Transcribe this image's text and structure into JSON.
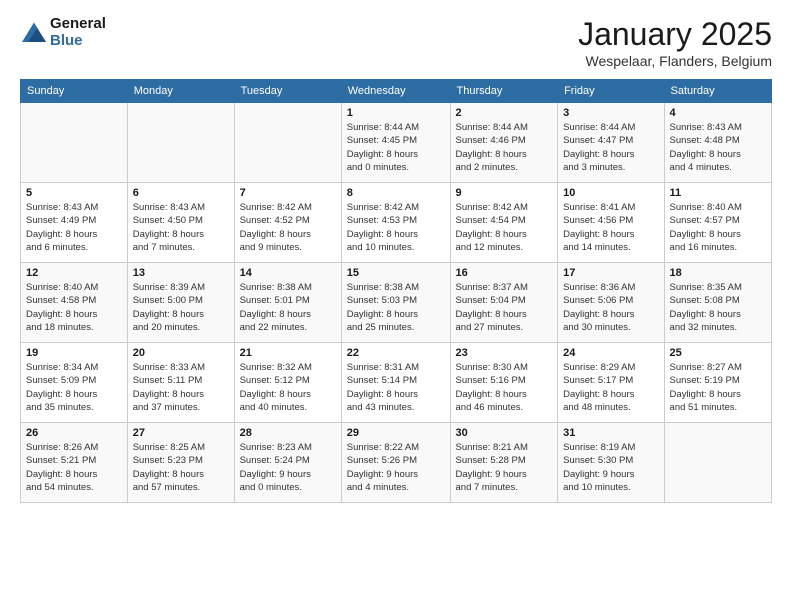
{
  "logo": {
    "line1": "General",
    "line2": "Blue"
  },
  "title": "January 2025",
  "location": "Wespelaar, Flanders, Belgium",
  "weekdays": [
    "Sunday",
    "Monday",
    "Tuesday",
    "Wednesday",
    "Thursday",
    "Friday",
    "Saturday"
  ],
  "weeks": [
    [
      {
        "day": "",
        "text": ""
      },
      {
        "day": "",
        "text": ""
      },
      {
        "day": "",
        "text": ""
      },
      {
        "day": "1",
        "text": "Sunrise: 8:44 AM\nSunset: 4:45 PM\nDaylight: 8 hours\nand 0 minutes."
      },
      {
        "day": "2",
        "text": "Sunrise: 8:44 AM\nSunset: 4:46 PM\nDaylight: 8 hours\nand 2 minutes."
      },
      {
        "day": "3",
        "text": "Sunrise: 8:44 AM\nSunset: 4:47 PM\nDaylight: 8 hours\nand 3 minutes."
      },
      {
        "day": "4",
        "text": "Sunrise: 8:43 AM\nSunset: 4:48 PM\nDaylight: 8 hours\nand 4 minutes."
      }
    ],
    [
      {
        "day": "5",
        "text": "Sunrise: 8:43 AM\nSunset: 4:49 PM\nDaylight: 8 hours\nand 6 minutes."
      },
      {
        "day": "6",
        "text": "Sunrise: 8:43 AM\nSunset: 4:50 PM\nDaylight: 8 hours\nand 7 minutes."
      },
      {
        "day": "7",
        "text": "Sunrise: 8:42 AM\nSunset: 4:52 PM\nDaylight: 8 hours\nand 9 minutes."
      },
      {
        "day": "8",
        "text": "Sunrise: 8:42 AM\nSunset: 4:53 PM\nDaylight: 8 hours\nand 10 minutes."
      },
      {
        "day": "9",
        "text": "Sunrise: 8:42 AM\nSunset: 4:54 PM\nDaylight: 8 hours\nand 12 minutes."
      },
      {
        "day": "10",
        "text": "Sunrise: 8:41 AM\nSunset: 4:56 PM\nDaylight: 8 hours\nand 14 minutes."
      },
      {
        "day": "11",
        "text": "Sunrise: 8:40 AM\nSunset: 4:57 PM\nDaylight: 8 hours\nand 16 minutes."
      }
    ],
    [
      {
        "day": "12",
        "text": "Sunrise: 8:40 AM\nSunset: 4:58 PM\nDaylight: 8 hours\nand 18 minutes."
      },
      {
        "day": "13",
        "text": "Sunrise: 8:39 AM\nSunset: 5:00 PM\nDaylight: 8 hours\nand 20 minutes."
      },
      {
        "day": "14",
        "text": "Sunrise: 8:38 AM\nSunset: 5:01 PM\nDaylight: 8 hours\nand 22 minutes."
      },
      {
        "day": "15",
        "text": "Sunrise: 8:38 AM\nSunset: 5:03 PM\nDaylight: 8 hours\nand 25 minutes."
      },
      {
        "day": "16",
        "text": "Sunrise: 8:37 AM\nSunset: 5:04 PM\nDaylight: 8 hours\nand 27 minutes."
      },
      {
        "day": "17",
        "text": "Sunrise: 8:36 AM\nSunset: 5:06 PM\nDaylight: 8 hours\nand 30 minutes."
      },
      {
        "day": "18",
        "text": "Sunrise: 8:35 AM\nSunset: 5:08 PM\nDaylight: 8 hours\nand 32 minutes."
      }
    ],
    [
      {
        "day": "19",
        "text": "Sunrise: 8:34 AM\nSunset: 5:09 PM\nDaylight: 8 hours\nand 35 minutes."
      },
      {
        "day": "20",
        "text": "Sunrise: 8:33 AM\nSunset: 5:11 PM\nDaylight: 8 hours\nand 37 minutes."
      },
      {
        "day": "21",
        "text": "Sunrise: 8:32 AM\nSunset: 5:12 PM\nDaylight: 8 hours\nand 40 minutes."
      },
      {
        "day": "22",
        "text": "Sunrise: 8:31 AM\nSunset: 5:14 PM\nDaylight: 8 hours\nand 43 minutes."
      },
      {
        "day": "23",
        "text": "Sunrise: 8:30 AM\nSunset: 5:16 PM\nDaylight: 8 hours\nand 46 minutes."
      },
      {
        "day": "24",
        "text": "Sunrise: 8:29 AM\nSunset: 5:17 PM\nDaylight: 8 hours\nand 48 minutes."
      },
      {
        "day": "25",
        "text": "Sunrise: 8:27 AM\nSunset: 5:19 PM\nDaylight: 8 hours\nand 51 minutes."
      }
    ],
    [
      {
        "day": "26",
        "text": "Sunrise: 8:26 AM\nSunset: 5:21 PM\nDaylight: 8 hours\nand 54 minutes."
      },
      {
        "day": "27",
        "text": "Sunrise: 8:25 AM\nSunset: 5:23 PM\nDaylight: 8 hours\nand 57 minutes."
      },
      {
        "day": "28",
        "text": "Sunrise: 8:23 AM\nSunset: 5:24 PM\nDaylight: 9 hours\nand 0 minutes."
      },
      {
        "day": "29",
        "text": "Sunrise: 8:22 AM\nSunset: 5:26 PM\nDaylight: 9 hours\nand 4 minutes."
      },
      {
        "day": "30",
        "text": "Sunrise: 8:21 AM\nSunset: 5:28 PM\nDaylight: 9 hours\nand 7 minutes."
      },
      {
        "day": "31",
        "text": "Sunrise: 8:19 AM\nSunset: 5:30 PM\nDaylight: 9 hours\nand 10 minutes."
      },
      {
        "day": "",
        "text": ""
      }
    ]
  ]
}
